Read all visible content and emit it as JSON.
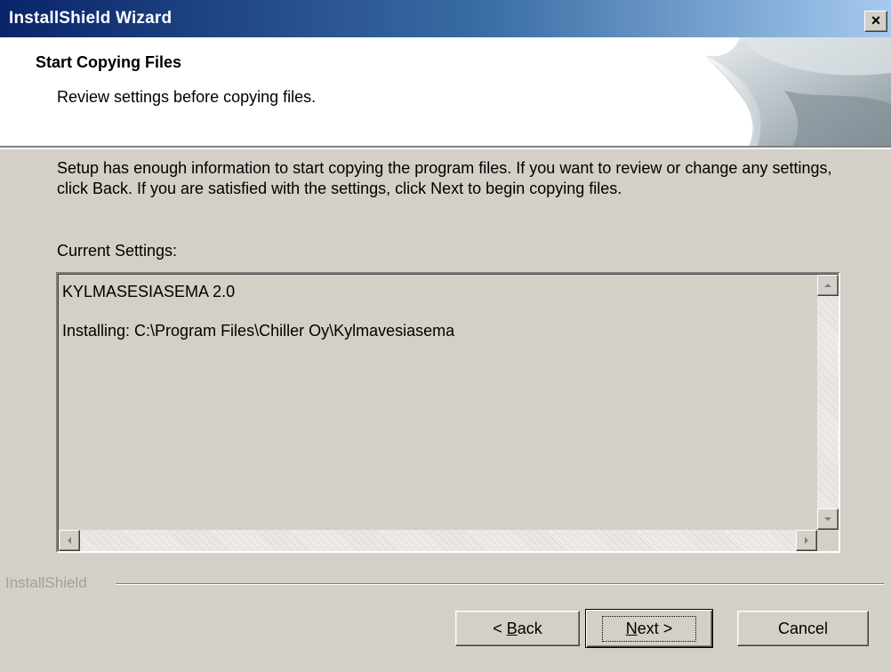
{
  "window": {
    "title": "InstallShield Wizard",
    "close_glyph": "×"
  },
  "header": {
    "title": "Start Copying Files",
    "subtitle": "Review settings before copying files."
  },
  "body": {
    "intro": "Setup has enough information to start copying the program files.  If you want to review or change any settings, click Back.  If you are satisfied with the settings, click Next to begin copying files.",
    "settings_label": "Current Settings:",
    "settings_lines": [
      "KYLMASESIASEMA 2.0",
      "Installing: C:\\Program Files\\Chiller Oy\\Kylmavesiasema"
    ]
  },
  "footer": {
    "brand": "InstallShield",
    "back": {
      "prefix": "< ",
      "mnemonic": "B",
      "rest": "ack"
    },
    "next": {
      "mnemonic": "N",
      "rest": "ext >"
    },
    "cancel": "Cancel"
  },
  "colors": {
    "titlebar_start": "#0a246a",
    "titlebar_end": "#a6caf0",
    "face": "#d4d0c8"
  },
  "icons": {
    "close": "close-icon",
    "scroll_up": "arrow-up-icon",
    "scroll_down": "arrow-down-icon",
    "scroll_left": "arrow-left-icon",
    "scroll_right": "arrow-right-icon"
  }
}
